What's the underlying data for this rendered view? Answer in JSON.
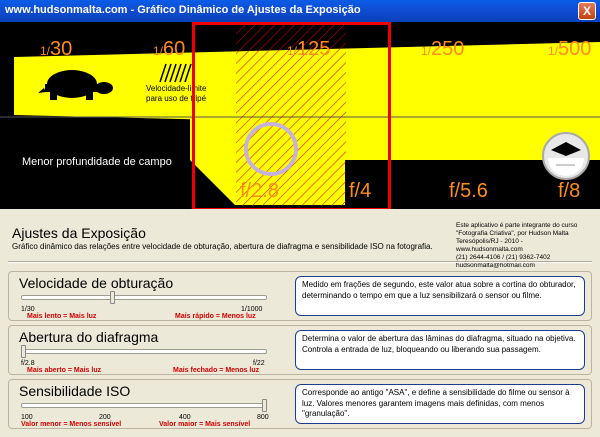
{
  "window": {
    "title": "www.hudsonmalta.com - Gráfico Dinâmico de Ajustes da Exposição",
    "close_label": "X"
  },
  "viz": {
    "speeds": [
      {
        "top": "1/",
        "bottom": "30"
      },
      {
        "top": "1/",
        "bottom": "60"
      },
      {
        "top": "1/",
        "bottom": "125"
      },
      {
        "top": "1/",
        "bottom": "250"
      },
      {
        "top": "1/",
        "bottom": "500"
      }
    ],
    "apertures": [
      "f/2.8",
      "f/4",
      "f/5.6",
      "f/8"
    ],
    "speed_note_line1": "Velocidade-limite",
    "speed_note_line2": "para uso de tripé",
    "depth_label": "Menor profundidade de campo",
    "colors": {
      "accent": "#ff8c1a",
      "beam": "#ffff00",
      "frame": "#e00000"
    },
    "icons": [
      "turtle-icon",
      "shutter-icon"
    ]
  },
  "header": {
    "title": "Ajustes da Exposição",
    "subtitle": "Gráfico dinâmico das relações entre velocidade de obturação, abertura de diafragma e sensibilidade ISO na fotografia.",
    "credits": [
      "Este aplicativo é parte integrante do curso",
      "\"Fotografia Criativa\", por Hudson Malta",
      "Teresópolis/RJ - 2010 -",
      "www.hudsonmalta.com",
      "(21) 2644-4106  /  (21) 9362-7402",
      "hudsonmalta@hotmail.com"
    ]
  },
  "shutter": {
    "title": "Velocidade de obturação",
    "min_label": "1/30",
    "max_label": "1/1000",
    "hint_low": "Mais lento = Mais luz",
    "hint_high": "Mais rápido = Menos luz",
    "position": 0.37,
    "description": "Medido em frações de segundo, este valor atua sobre a cortina do obturador, determinando o tempo em que a luz sensibilizará o sensor ou filme."
  },
  "aperture": {
    "title": "Abertura do diafragma",
    "min_label": "f/2.8",
    "max_label": "f/22",
    "hint_low": "Mais aberto = Mais luz",
    "hint_high": "Mais fechado = Menos luz",
    "position": 0.0,
    "description": "Determina o valor de abertura das lâminas do diafragma, situado na objetiva. Controla a entrada de luz, bloqueando ou liberando sua passagem."
  },
  "iso": {
    "title": "Sensibilidade ISO",
    "ticks": [
      "100",
      "200",
      "400",
      "800"
    ],
    "hint_low": "Valor menor = Menos sensível",
    "hint_high": "Valor maior = Mais sensível",
    "position": 1.0,
    "description": "Corresponde ao antigo \"ASA\", e define  a sensibilidade do filme ou sensor à luz. Valores menores garantem imagens mais definidas, com menos \"granulação\"."
  }
}
